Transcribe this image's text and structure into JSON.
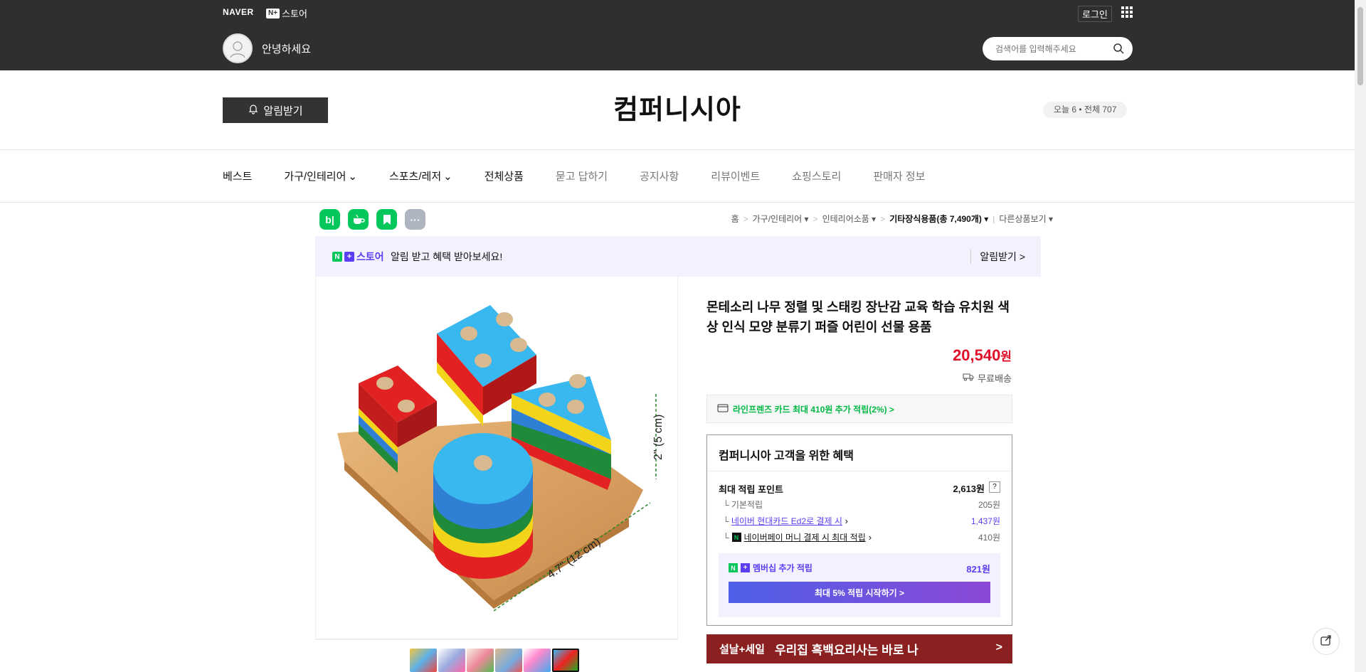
{
  "topbar": {
    "naver": "NAVER",
    "np_badge": "N+",
    "np_label": "스토어",
    "login": "로그인",
    "greeting": "안녕하세요",
    "search_placeholder": "검색어를 입력해주세요"
  },
  "header": {
    "alarm_label": "알림받기",
    "store_name": "컴퍼니시아",
    "visitors": "오늘 6 • 전체 707"
  },
  "nav": {
    "items": [
      {
        "label": "베스트",
        "dropdown": false
      },
      {
        "label": "가구/인테리어",
        "dropdown": true
      },
      {
        "label": "스포츠/레저",
        "dropdown": true
      },
      {
        "label": "전체상품",
        "dropdown": false
      },
      {
        "label": "묻고 답하기",
        "dropdown": false
      },
      {
        "label": "공지사항",
        "dropdown": false
      },
      {
        "label": "리뷰이벤트",
        "dropdown": false
      },
      {
        "label": "쇼핑스토리",
        "dropdown": false
      },
      {
        "label": "판매자 정보",
        "dropdown": false
      }
    ]
  },
  "share": {
    "blog": "b|",
    "more": "···"
  },
  "breadcrumb": {
    "home": "홈",
    "c1": "가구/인테리어",
    "c2": "인테리어소품",
    "c3": "기타장식용품(총 7,490개)",
    "other": "다른상품보기",
    "sep": ">"
  },
  "promo": {
    "np_n": "N",
    "np_plus": "+",
    "np_label": "스토어",
    "message": "알림 받고 혜택 받아보세요!",
    "action": "알림받기 >"
  },
  "product": {
    "title": "몬테소리 나무 정렬 및 스태킹 장난감 교육 학습 유치원 색상 인식 모양 분류기 퍼즐 어린이 선물 용품",
    "price": "20,540",
    "currency": "원",
    "shipping": "무료배송",
    "image_label_1": "2\" (5 cm)",
    "image_label_2": "4.7\" (12 cm)"
  },
  "card_benefit": "라인프렌즈 카드 최대 410원 추가 적립(2%) >",
  "benefit": {
    "title": "컴퍼니시아 고객을 위한 혜택",
    "max_points_label": "최대 적립 포인트",
    "max_points_value": "2,613원",
    "help": "?",
    "basic_label": "기본적립",
    "basic_value": "205원",
    "card_label": "네이버 현대카드 Ed2로 결제 시",
    "card_value": "1,437원",
    "pay_label": "네이버페이 머니 결제 시 최대 적립",
    "pay_value": "410원",
    "membership_label": "멤버십 추가 적립",
    "membership_value": "821원",
    "membership_button": "최대 5% 적립 시작하기 >"
  },
  "banner": {
    "tag": "설날+세일",
    "text": "우리집 흑백요리사는 바로 나",
    "arrow": ">"
  },
  "colors": {
    "topbar": "#2f2f2f",
    "price": "#e0102b",
    "naver_green": "#03c75a",
    "accent_purple": "#5a3ef2",
    "banner": "#8b2020"
  }
}
